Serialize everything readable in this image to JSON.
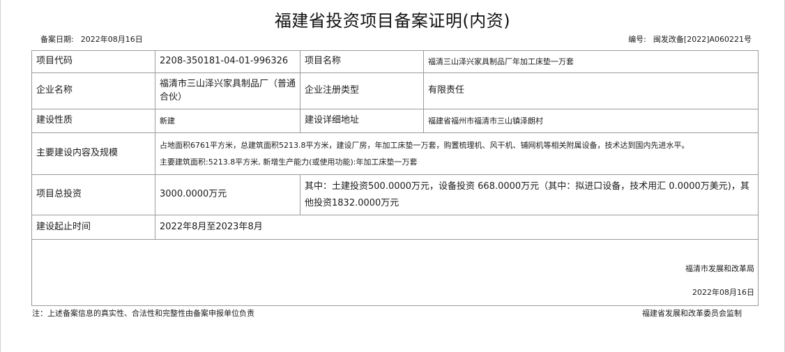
{
  "header": {
    "title": "福建省投资项目备案证明(内资)",
    "date_label": "备案日期:",
    "date_value": "2022年08月16日",
    "number_label": "编号:",
    "number_value": "闽发改备[2022]A060221号"
  },
  "rows": {
    "project_code": {
      "label": "项目代码",
      "value": "2208-350181-04-01-996326"
    },
    "project_name": {
      "label": "项目名称",
      "value": "福清三山泽兴家具制品厂年加工床垫一万套"
    },
    "company_name": {
      "label": "企业名称",
      "value": "福清市三山泽兴家具制品厂（普通合伙）"
    },
    "company_type": {
      "label": "企业注册类型",
      "value": "有限责任"
    },
    "construction_nature": {
      "label": "建设性质",
      "value": "新建"
    },
    "address": {
      "label": "建设详细地址",
      "value": "福建省福州市福清市三山镇泽朗村"
    },
    "scope": {
      "label": "主要建设内容及规模",
      "line1": "占地面积6761平方米，总建筑面积5213.8平方米，建设厂房，年加工床垫一万套，购置梳理机、风干机、铺网机等相关附属设备，技术达到国内先进水平。",
      "line2": "主要建筑面积:5213.8平方米, 新增生产能力(或使用功能):年加工床垫一万套"
    },
    "investment": {
      "label": "项目总投资",
      "value": "3000.0000万元",
      "breakdown": "其中：土建投资500.0000万元，设备投资 668.0000万元（其中：拟进口设备，技术用汇 0.0000万美元)，其他投资1832.0000万元"
    },
    "period": {
      "label": "建设起止时间",
      "value": "2022年8月至2023年8月"
    }
  },
  "signature": {
    "organization": "福清市发展和改革局",
    "date": "2022年08月16日"
  },
  "footer": {
    "note": "注：上述备案信息的真实性、合法性和完整性由备案申报单位负责",
    "supervisor": "福建省发展和改革委员会监制"
  }
}
